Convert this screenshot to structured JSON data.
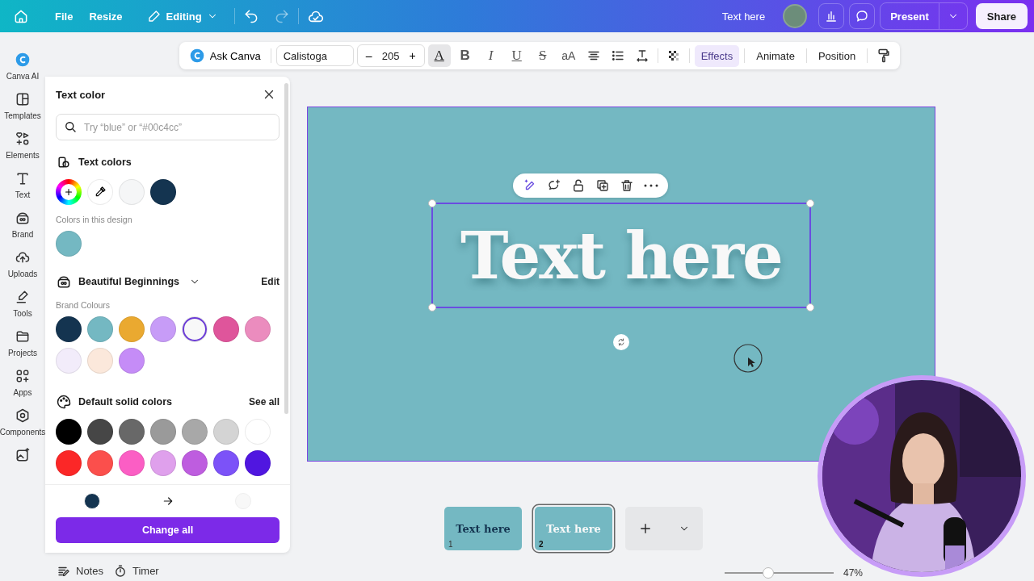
{
  "topbar": {
    "menu": [
      "File",
      "Resize"
    ],
    "mode": "Editing",
    "title": "Text here",
    "present": "Present",
    "share": "Share"
  },
  "toolbar": {
    "ask": "Ask Canva",
    "font": "Calistoga",
    "minus": "–",
    "size": "205",
    "plus": "+",
    "format": [
      {
        "label": "A",
        "selected": true
      },
      {
        "label": "B",
        "selected": false
      },
      {
        "label": "I",
        "selected": false
      },
      {
        "label": "U",
        "selected": false
      },
      {
        "label": "S",
        "selected": false
      },
      {
        "label": "aA",
        "selected": false
      }
    ],
    "actions": [
      {
        "label": "Effects",
        "selected": true
      },
      {
        "label": "Animate",
        "selected": false
      },
      {
        "label": "Position",
        "selected": false
      }
    ]
  },
  "rail": [
    {
      "label": "Canva AI",
      "kind": "ai"
    },
    {
      "label": "Templates",
      "kind": "templates"
    },
    {
      "label": "Elements",
      "kind": "elements"
    },
    {
      "label": "Text",
      "kind": "text"
    },
    {
      "label": "Brand",
      "kind": "brand"
    },
    {
      "label": "Uploads",
      "kind": "uploads"
    },
    {
      "label": "Tools",
      "kind": "tools"
    },
    {
      "label": "Projects",
      "kind": "projects"
    },
    {
      "label": "Apps",
      "kind": "apps"
    },
    {
      "label": "Components",
      "kind": "components"
    },
    {
      "kind": "magic"
    }
  ],
  "panel": {
    "title": "Text color",
    "search": {
      "placeholder": "Try “blue” or “#00c4cc”"
    },
    "text_colors": {
      "title": "Text colors",
      "swatches": [
        {
          "color": "#f5f6f7",
          "selected": false
        },
        {
          "color": "#143450",
          "selected": false
        }
      ]
    },
    "design_colors": {
      "title": "Colors in this design",
      "swatches": [
        {
          "color": "#74b8c2",
          "selected": false
        }
      ]
    },
    "brand": {
      "title": "Beautiful Beginnings",
      "edit": "Edit",
      "subtitle": "Brand Colours",
      "swatches": [
        {
          "color": "#143450",
          "selected": false
        },
        {
          "color": "#74b8c2",
          "selected": false
        },
        {
          "color": "#eaa930",
          "selected": false
        },
        {
          "color": "#c79cf7",
          "selected": false
        },
        {
          "color": "#f8f8f8",
          "selected": true
        },
        {
          "color": "#df559b",
          "selected": false
        },
        {
          "color": "#eb8cbe",
          "selected": false
        },
        {
          "color": "#f2ecfa",
          "selected": false
        },
        {
          "color": "#fbe8db",
          "selected": false
        },
        {
          "color": "#c58cf7",
          "selected": false
        }
      ]
    },
    "defaults": {
      "title": "Default solid colors",
      "see_all": "See all",
      "swatches": [
        {
          "color": "#000000",
          "selected": false
        },
        {
          "color": "#464646",
          "selected": false
        },
        {
          "color": "#686868",
          "selected": false
        },
        {
          "color": "#9a9a9a",
          "selected": false
        },
        {
          "color": "#a8a8a8",
          "selected": false
        },
        {
          "color": "#d4d4d4",
          "selected": false
        },
        {
          "color": "#ffffff",
          "selected": false
        },
        {
          "color": "#fb2727",
          "selected": false
        },
        {
          "color": "#fb4f4c",
          "selected": false
        },
        {
          "color": "#fb5ec4",
          "selected": false
        },
        {
          "color": "#dfa0ec",
          "selected": false
        },
        {
          "color": "#be5ddf",
          "selected": false
        },
        {
          "color": "#7c52f8",
          "selected": false
        },
        {
          "color": "#5016e0",
          "selected": false
        }
      ]
    },
    "replace": [
      {
        "color": "#143450"
      },
      {
        "color": "#f8f8f8"
      }
    ],
    "button": "Change all"
  },
  "canvas": {
    "text": "Text here"
  },
  "pages": [
    {
      "label": "Text here",
      "number": "1",
      "kind": "dark",
      "selected": false
    },
    {
      "label": "Text here",
      "number": "2",
      "kind": "light",
      "selected": true
    }
  ],
  "bottombar": {
    "notes": "Notes",
    "timer": "Timer",
    "zoom": {
      "level": 0.4,
      "reading": "47%"
    }
  }
}
